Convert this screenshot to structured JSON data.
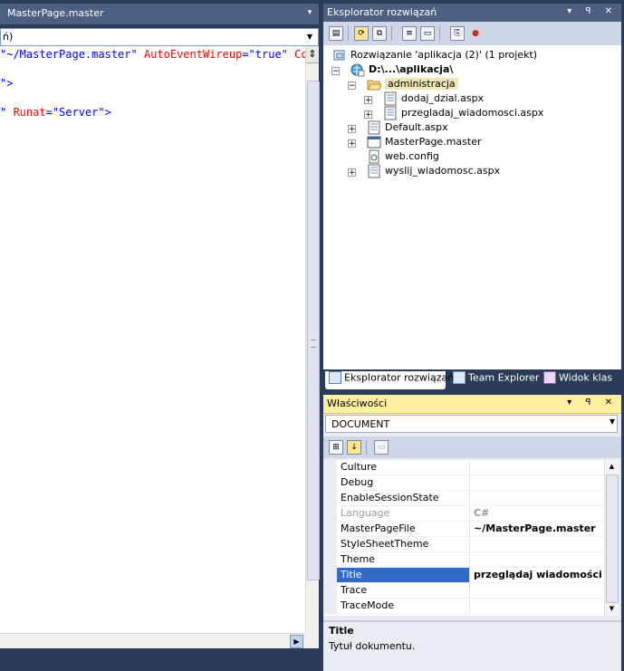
{
  "editor": {
    "tab_title": "MasterPage.master",
    "combo_value": "ń)",
    "code_lines": [
      {
        "parts": [
          {
            "t": "\"~/MasterPage.master\"",
            "c": "blue"
          },
          {
            "t": " AutoEventWireup",
            "c": "red"
          },
          {
            "t": "=",
            "c": "blue"
          },
          {
            "t": "\"true\"",
            "c": "blue"
          },
          {
            "t": " Cod",
            "c": "red"
          }
        ]
      },
      {
        "parts": [
          {
            "t": "\">",
            "c": "blue"
          }
        ]
      },
      {
        "parts": [
          {
            "t": "\"",
            "c": "blue"
          },
          {
            "t": " Runat",
            "c": "red"
          },
          {
            "t": "=",
            "c": "blue"
          },
          {
            "t": "\"Server\"",
            "c": "blue"
          },
          {
            "t": ">",
            "c": "blue"
          }
        ]
      }
    ]
  },
  "solution_explorer": {
    "title": "Eksplorator rozwiązań",
    "header_buttons": "▾ ꟼ ✕",
    "solution": "Rozwiązanie 'aplikacja (2)' (1 projekt)",
    "project": "D:\\...\\aplikacja\\",
    "folder": "administracja",
    "folder_files": [
      "dodaj_dzial.aspx",
      "przegladaj_wiadomosci.aspx"
    ],
    "files": [
      "Default.aspx",
      "MasterPage.master",
      "web.config",
      "wyslij_wiadomosc.aspx"
    ],
    "bottom_tabs": [
      "Eksplorator rozwiązań",
      "Team Explorer",
      "Widok klas"
    ]
  },
  "properties": {
    "title": "Właściwości",
    "object": "DOCUMENT",
    "rows": [
      {
        "name": "Culture",
        "value": ""
      },
      {
        "name": "Debug",
        "value": ""
      },
      {
        "name": "EnableSessionState",
        "value": ""
      },
      {
        "name": "Language",
        "value": "C#",
        "disabled": true
      },
      {
        "name": "MasterPageFile",
        "value": "~/MasterPage.master"
      },
      {
        "name": "StyleSheetTheme",
        "value": ""
      },
      {
        "name": "Theme",
        "value": ""
      },
      {
        "name": "Title",
        "value": "przeglądaj wiadomości",
        "selected": true
      },
      {
        "name": "Trace",
        "value": ""
      },
      {
        "name": "TraceMode",
        "value": ""
      }
    ],
    "desc_title": "Title",
    "desc_text": "Tytuł dokumentu."
  }
}
